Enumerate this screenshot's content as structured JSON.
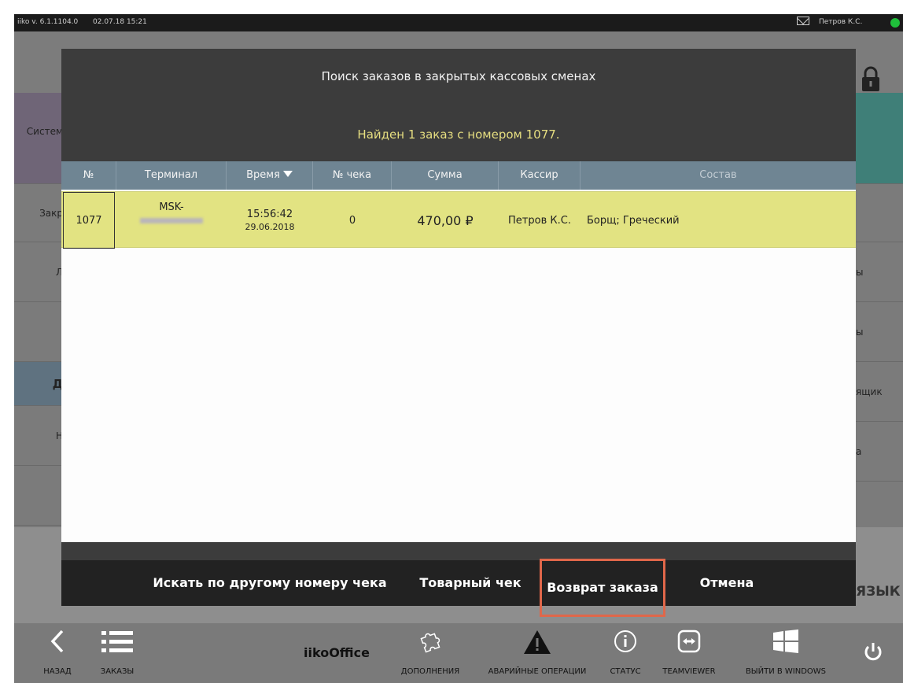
{
  "topbar": {
    "version": "iiko v. 6.1.1104.0",
    "datetime": "02.07.18  15:21",
    "user": "Петров К.С.",
    "status_color": "#1fbf3b"
  },
  "background": {
    "left_tiles": [
      "Систем",
      "Закр",
      "Л",
      "",
      "Д",
      "Н",
      ""
    ],
    "right_tiles": [
      "",
      "",
      "ы",
      "ы",
      "ящик",
      "а"
    ],
    "lang_label": "язык"
  },
  "dialog": {
    "title": "Поиск заказов в закрытых кассовых сменах",
    "found_text": "Найден 1 заказ с номером 1077.",
    "columns": [
      "№",
      "Терминал",
      "Время",
      "№ чека",
      "Сумма",
      "Кассир",
      "Состав"
    ],
    "rows": [
      {
        "number": "1077",
        "terminal": "MSK-",
        "time": "15:56:42",
        "date": "29.06.2018",
        "check": "0",
        "sum": "470,00 ₽",
        "cashier": "Петров К.С.",
        "items": "Борщ; Греческий"
      }
    ],
    "actions": {
      "search_other": "Искать по другому номеру чека",
      "receipt": "Товарный чек",
      "return_order": "Возврат заказа",
      "cancel": "Отмена"
    },
    "highlight_color": "#e0674a"
  },
  "bottombar": {
    "back": "НАЗАД",
    "orders": "ЗАКАЗЫ",
    "office": "iikoOffice",
    "addons": "ДОПОЛНЕНИЯ",
    "emergency": "АВАРИЙНЫЕ ОПЕРАЦИИ",
    "status": "СТАТУС",
    "teamviewer": "TEAMVIEWER",
    "exit_windows": "ВЫЙТИ В WINDOWS"
  }
}
